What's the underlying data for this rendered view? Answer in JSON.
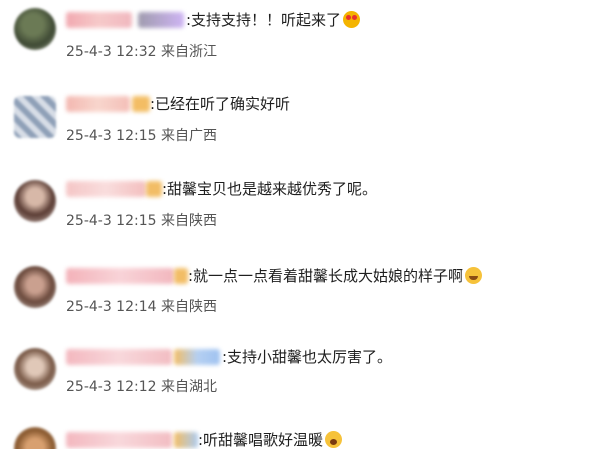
{
  "comments": [
    {
      "text": ":支持支持！！听起来了",
      "time": "25-4-3 12:32",
      "location": "来自浙江",
      "emoji": "heart-eyes-emoji"
    },
    {
      "text": ":已经在听了确实好听",
      "time": "25-4-3 12:15",
      "location": "来自广西",
      "emoji": ""
    },
    {
      "text": ":甜馨宝贝也是越来越优秀了呢。",
      "time": "25-4-3 12:15",
      "location": "来自陕西",
      "emoji": ""
    },
    {
      "text": ":就一点一点看着甜馨长成大姑娘的样子啊",
      "time": "25-4-3 12:14",
      "location": "来自陕西",
      "emoji": "blush-emoji"
    },
    {
      "text": ":支持小甜馨也太厉害了。",
      "time": "25-4-3 12:12",
      "location": "来自湖北",
      "emoji": ""
    },
    {
      "text": ":听甜馨唱歌好温暖",
      "time": "",
      "location": "",
      "emoji": "crying-emoji"
    }
  ],
  "colors": {
    "text": "#1f1f1f",
    "meta": "#555555",
    "name_blur": "#f2b6b6",
    "badge_blur": "#c9b7f0"
  }
}
